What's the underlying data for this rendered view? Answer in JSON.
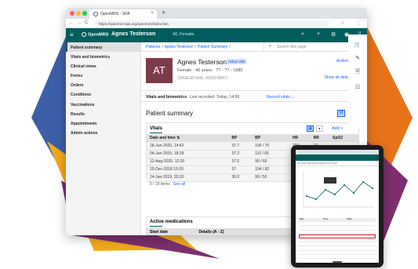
{
  "browser": {
    "tab_title": "OpenMRS - SPA",
    "tab_close": "×",
    "new_tab": "+",
    "url": "https://openmrs-spa.org/openmrs/index.htm",
    "nav_back": "←",
    "nav_forward": "→",
    "nav_reload": "C",
    "star": "☆",
    "menu": "⋮"
  },
  "app_header": {
    "menu_icon": "≡",
    "brand": "OpenMRS",
    "patient_name": "Agnes Testerson",
    "patient_meta": "40, Female",
    "search_icon": "⌕",
    "add_icon": "+",
    "settings_icon": "⚙",
    "user_icon": "◉",
    "apps_icon": "⠿"
  },
  "sidebar": {
    "items": [
      {
        "label": "Patient summary",
        "active": true
      },
      {
        "label": "Vitals and biometrics"
      },
      {
        "label": "Clinical views"
      },
      {
        "label": "Forms"
      },
      {
        "label": "Orders"
      },
      {
        "label": "Conditions"
      },
      {
        "label": "Vaccinations"
      },
      {
        "label": "Results"
      },
      {
        "label": "Appointments"
      },
      {
        "label": "Admin actions"
      }
    ]
  },
  "breadcrumb": {
    "items": [
      "Patients",
      "Agnes Testerson",
      "Patient Summary"
    ],
    "sep": "/"
  },
  "search": {
    "placeholder": "Search this page",
    "icon": "⌕"
  },
  "banner": {
    "initials": "AT",
    "name": "Agnes Testerson",
    "badge": "Active Visit",
    "meta": "Female · 40 years · ?? - ?? - 1980",
    "ids": "100GEJ87eRE, 00001980FJ",
    "actions": "Actions ⋮",
    "show_all": "Show all details ⌄"
  },
  "vitals_bar": {
    "title": "Vitals and biometrics",
    "last_recorded": "Last recorded: Today, 14:56",
    "record": "Record vitals",
    "chevron": "⌄"
  },
  "summary": {
    "title": "Patient summary",
    "view_list": "▤",
    "view_grid": "▦"
  },
  "vitals_card": {
    "title": "Vitals",
    "table_icon": "▤",
    "chart_icon": "⫟",
    "add": "Add +",
    "columns": [
      "Date and time",
      "BP",
      "BP",
      "HR",
      "RR",
      "SpO2"
    ],
    "sort_icon": "⇅",
    "rows": [
      [
        "18-Jun-2020, 14:42",
        "37.7",
        "100 / 70",
        "110",
        "17",
        ""
      ],
      [
        "04-Jun-2019, 18:18",
        "37.2",
        "110 / 65",
        "107",
        "17",
        ""
      ],
      [
        "12-Aug-2020, 12:20",
        "37.6",
        "90 / 60",
        "103",
        "16",
        ""
      ],
      [
        "15-Dec-2018 15:20",
        "37",
        "104 / 82",
        "102",
        "17",
        ""
      ],
      [
        "14-Jan-2019, 20:20",
        "36.0",
        "90 / 50",
        "112",
        "16",
        ""
      ]
    ],
    "pager": "5 / 10 items",
    "see_all": "See all"
  },
  "meds": {
    "title": "Active medications",
    "columns": [
      "Start date",
      "Details (A - Z)"
    ]
  },
  "rail": {
    "icons": [
      "🛒",
      "✎",
      "🗎",
      "☷"
    ]
  },
  "tablet": {
    "tabs": "Overview   Vitals   Results   Orders   Forms   Visits",
    "tooltip": "",
    "table_rows": [
      {
        "c1": "Date",
        "c2": "Time",
        "c3": "Value"
      },
      {
        "c1": "",
        "c2": "",
        "c3": ""
      },
      {
        "c1": "",
        "c2": "",
        "c3": ""
      },
      {
        "c1": "",
        "c2": "",
        "c3": ""
      },
      {
        "c1": "",
        "c2": "",
        "c3": ""
      },
      {
        "c1": "",
        "c2": "",
        "c3": ""
      },
      {
        "c1": "",
        "c2": "",
        "c3": ""
      },
      {
        "c1": "",
        "c2": "",
        "c3": ""
      },
      {
        "c1": "",
        "c2": "",
        "c3": ""
      },
      {
        "c1": "",
        "c2": "",
        "c3": ""
      },
      {
        "c1": "",
        "c2": "",
        "c3": ""
      }
    ]
  },
  "colors": {
    "brand_teal": "#005d5d",
    "link_blue": "#0f62fe",
    "avatar": "#7d3b4a",
    "deco_blue": "#3d5fa8",
    "deco_orange": "#e8731a",
    "deco_purple": "#7b2f6e",
    "deco_yellow": "#f2a81d"
  }
}
